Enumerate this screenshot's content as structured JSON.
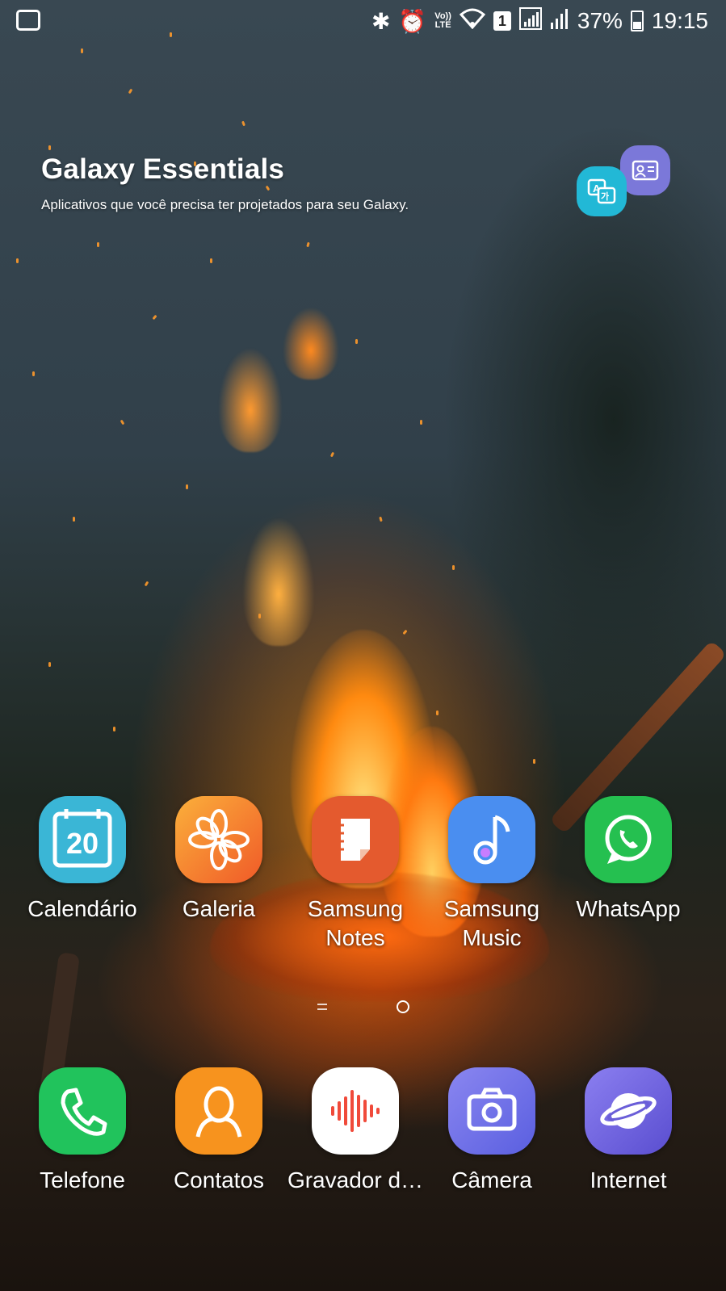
{
  "status_bar": {
    "battery_percent": "37%",
    "time": "19:15",
    "sim_badge": "1",
    "volte_top": "Vo))",
    "volte_bottom": "LTE"
  },
  "widget": {
    "title": "Galaxy Essentials",
    "subtitle": "Aplicativos que você precisa ter projetados para seu Galaxy."
  },
  "apps_row": [
    {
      "label": "Calendário",
      "icon": "calendar-icon",
      "date": "20",
      "color": "#3ab6d6"
    },
    {
      "label": "Galeria",
      "icon": "gallery-flower-icon",
      "color": "#f58a2a"
    },
    {
      "label": "Samsung Notes",
      "icon": "notes-icon",
      "color": "#e45a2e"
    },
    {
      "label": "Samsung Music",
      "icon": "music-note-icon",
      "color": "#4a8ef0"
    },
    {
      "label": "WhatsApp",
      "icon": "whatsapp-icon",
      "color": "#25c050"
    }
  ],
  "dock": [
    {
      "label": "Telefone",
      "icon": "phone-icon",
      "color": "#21c35c"
    },
    {
      "label": "Contatos",
      "icon": "contacts-icon",
      "color": "#f7931e"
    },
    {
      "label": "Gravador d…",
      "icon": "voice-recorder-icon",
      "color": "#ffffff"
    },
    {
      "label": "Câmera",
      "icon": "camera-icon",
      "color": "#6b6ee8"
    },
    {
      "label": "Internet",
      "icon": "internet-planet-icon",
      "color": "#6a5ed8"
    }
  ]
}
